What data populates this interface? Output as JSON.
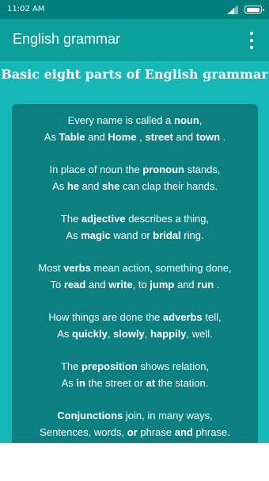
{
  "status_bar": {
    "time": "11:02 AM",
    "icons": [
      "signal-icon",
      "battery-icon"
    ]
  },
  "app_bar": {
    "title": "English grammar",
    "menu_icon": "more-vert-icon"
  },
  "content": {
    "heading": "Basic eight parts of English grammar",
    "verses": [
      {
        "lines": [
          [
            {
              "t": "Every name is called a "
            },
            {
              "t": "noun",
              "b": true
            },
            {
              "t": ","
            }
          ],
          [
            {
              "t": "As "
            },
            {
              "t": "Table",
              "b": true
            },
            {
              "t": " and "
            },
            {
              "t": "Home",
              "b": true
            },
            {
              "t": " , "
            },
            {
              "t": "street",
              "b": true
            },
            {
              "t": " and "
            },
            {
              "t": "town",
              "b": true
            },
            {
              "t": " ."
            }
          ]
        ]
      },
      {
        "lines": [
          [
            {
              "t": "In place of noun the "
            },
            {
              "t": "pronoun",
              "b": true
            },
            {
              "t": " stands,"
            }
          ],
          [
            {
              "t": "As "
            },
            {
              "t": "he",
              "b": true
            },
            {
              "t": " and "
            },
            {
              "t": "she",
              "b": true
            },
            {
              "t": " can clap their hands."
            }
          ]
        ]
      },
      {
        "lines": [
          [
            {
              "t": "The "
            },
            {
              "t": "adjective",
              "b": true
            },
            {
              "t": " describes a thing,"
            }
          ],
          [
            {
              "t": "As "
            },
            {
              "t": "magic",
              "b": true
            },
            {
              "t": " wand or "
            },
            {
              "t": "bridal",
              "b": true
            },
            {
              "t": " ring."
            }
          ]
        ]
      },
      {
        "lines": [
          [
            {
              "t": "Most "
            },
            {
              "t": "verbs",
              "b": true
            },
            {
              "t": " mean action, something done,"
            }
          ],
          [
            {
              "t": "To "
            },
            {
              "t": "read",
              "b": true
            },
            {
              "t": " and "
            },
            {
              "t": "write",
              "b": true
            },
            {
              "t": ", to "
            },
            {
              "t": "jump",
              "b": true
            },
            {
              "t": " and "
            },
            {
              "t": "run",
              "b": true
            },
            {
              "t": " ."
            }
          ]
        ]
      },
      {
        "lines": [
          [
            {
              "t": "How things are done the "
            },
            {
              "t": "adverbs",
              "b": true
            },
            {
              "t": " tell,"
            }
          ],
          [
            {
              "t": "As "
            },
            {
              "t": "quickly",
              "b": true
            },
            {
              "t": ", "
            },
            {
              "t": "slowly",
              "b": true
            },
            {
              "t": ", "
            },
            {
              "t": "happily",
              "b": true
            },
            {
              "t": ", well."
            }
          ]
        ]
      },
      {
        "lines": [
          [
            {
              "t": "The "
            },
            {
              "t": "preposition",
              "b": true
            },
            {
              "t": " shows relation,"
            }
          ],
          [
            {
              "t": "As "
            },
            {
              "t": "in",
              "b": true
            },
            {
              "t": " the street or "
            },
            {
              "t": "at",
              "b": true
            },
            {
              "t": " the station."
            }
          ]
        ]
      },
      {
        "lines": [
          [
            {
              "t": "Conjunctions",
              "b": true
            },
            {
              "t": " join, in many ways,"
            }
          ],
          [
            {
              "t": "Sentences, words, "
            },
            {
              "t": "or",
              "b": true
            },
            {
              "t": " phrase "
            },
            {
              "t": "and",
              "b": true
            },
            {
              "t": " phrase."
            }
          ]
        ]
      }
    ]
  },
  "colors": {
    "status_bar": "#00807d",
    "app_bar": "#0b9f9a",
    "background": "#15b8b7",
    "card": "#0c8081",
    "text": "#ffffff"
  }
}
